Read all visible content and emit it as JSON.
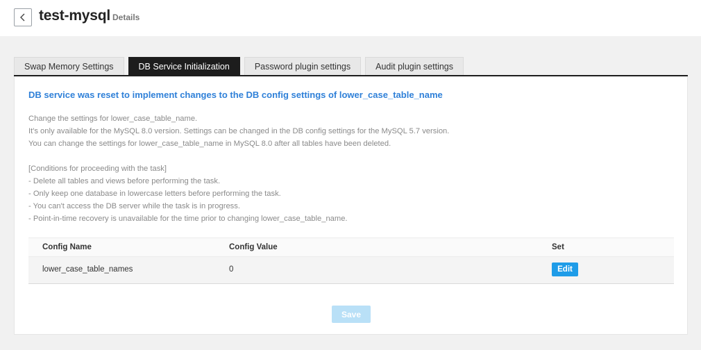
{
  "header": {
    "title": "test-mysql",
    "subtitle": "Details"
  },
  "tabs": [
    {
      "label": "Swap Memory Settings",
      "active": false
    },
    {
      "label": "DB Service Initialization",
      "active": true
    },
    {
      "label": "Password plugin settings",
      "active": false
    },
    {
      "label": "Audit plugin settings",
      "active": false
    }
  ],
  "panel": {
    "notice_title": "DB service was reset to implement changes to the DB config settings of lower_case_table_name",
    "description": [
      "Change the settings for lower_case_table_name.",
      "It's only available for the MySQL 8.0 version. Settings can be changed in the DB config settings for the MySQL 5.7 version.",
      "You can change the settings for lower_case_table_name in MySQL 8.0 after all tables have been deleted."
    ],
    "conditions": [
      "[Conditions for proceeding with the task]",
      "- Delete all tables and views before performing the task.",
      "- Only keep one database in lowercase letters before performing the task.",
      "- You can't access the DB server while the task is in progress.",
      "- Point-in-time recovery is unavailable for the time prior to changing lower_case_table_name."
    ],
    "table": {
      "headers": [
        "Config Name",
        "Config Value",
        "Set"
      ],
      "rows": [
        {
          "name": "lower_case_table_names",
          "value": "0",
          "action": "Edit"
        }
      ]
    },
    "save_label": "Save"
  },
  "colors": {
    "accent": "#2f80d8",
    "edit_button": "#1f9ce8",
    "save_disabled": "#b9e0f7",
    "active_tab": "#1d1d1d"
  }
}
